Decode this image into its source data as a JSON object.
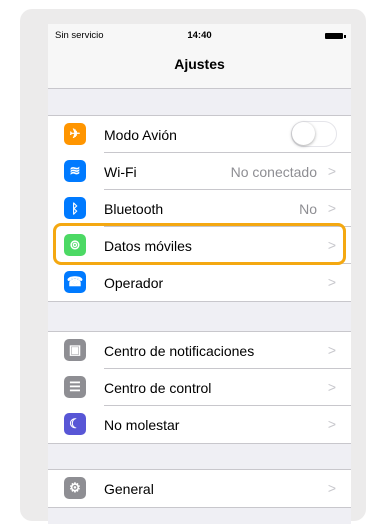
{
  "status_bar": {
    "carrier": "Sin servicio",
    "time": "14:40"
  },
  "nav": {
    "title": "Ajustes"
  },
  "colors": {
    "accent_highlight": "#f4a811",
    "airplane": "#ff9500",
    "wifi": "#007aff",
    "bluetooth": "#007aff",
    "cellular": "#4cd964",
    "carrier": "#007aff",
    "notifications": "#8e8e93",
    "control": "#8e8e93",
    "dnd": "#5856d6",
    "general": "#8e8e93"
  },
  "group1": [
    {
      "label": "Modo Avión",
      "icon": "airplane-icon",
      "glyph": "✈",
      "toggle": false
    },
    {
      "label": "Wi-Fi",
      "icon": "wifi-icon",
      "glyph": "≋",
      "value": "No conectado"
    },
    {
      "label": "Bluetooth",
      "icon": "bluetooth-icon",
      "glyph": "ᛒ",
      "value": "No"
    },
    {
      "label": "Datos móviles",
      "icon": "cellular-icon",
      "glyph": "⊚"
    },
    {
      "label": "Operador",
      "icon": "phone-icon",
      "glyph": "☎"
    }
  ],
  "group2": [
    {
      "label": "Centro de notificaciones",
      "icon": "notifications-icon",
      "glyph": "▣"
    },
    {
      "label": "Centro de control",
      "icon": "control-center-icon",
      "glyph": "☰"
    },
    {
      "label": "No molestar",
      "icon": "moon-icon",
      "glyph": "☾"
    }
  ],
  "group3": [
    {
      "label": "General",
      "icon": "gear-icon",
      "glyph": "⚙"
    }
  ],
  "chevron": ">"
}
